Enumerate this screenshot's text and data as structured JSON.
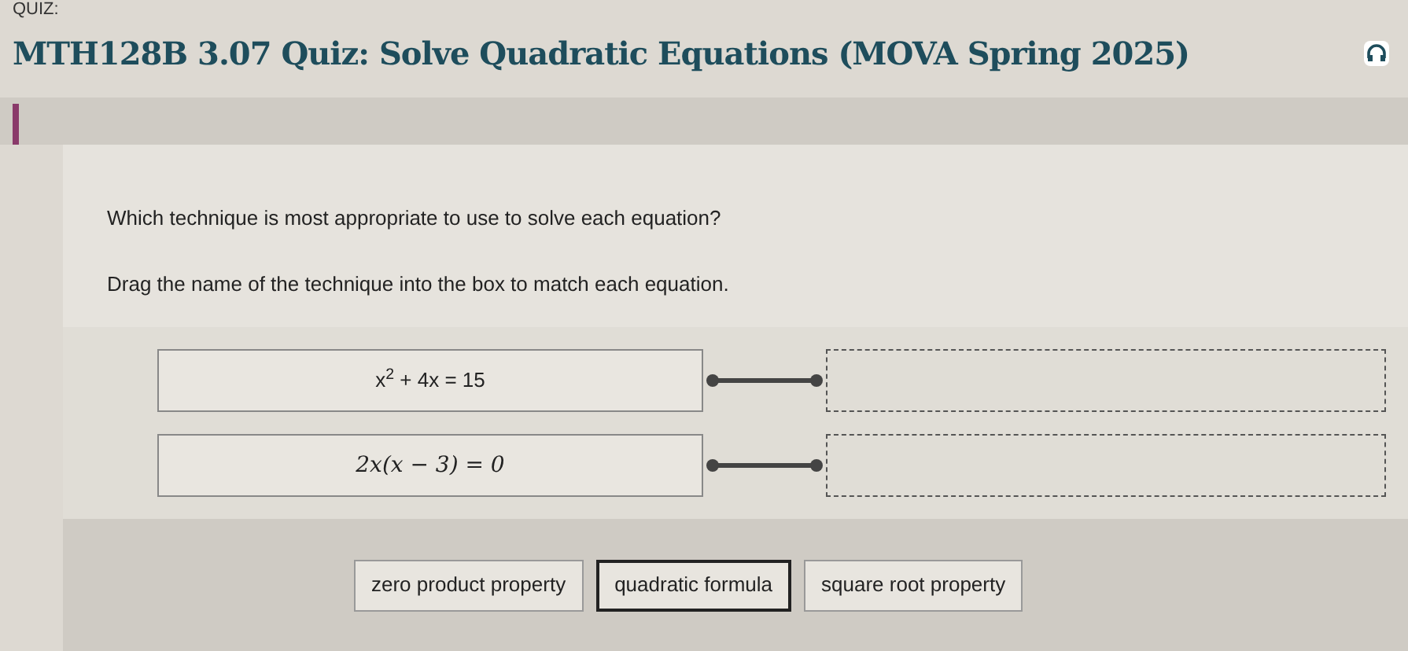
{
  "header": {
    "label": "QUIZ:",
    "title": "MTH128B 3.07 Quiz: Solve Quadratic Equations (MOVA Spring 2025)"
  },
  "question": {
    "prompt": "Which technique is most appropriate to use to solve each equation?",
    "instruction": "Drag the name of the technique into the box to match each equation."
  },
  "equations": [
    {
      "kind": "plain",
      "text": "x$^{2}$ + 4x = 15"
    },
    {
      "kind": "math",
      "text": "2x(x − 3) = 0"
    }
  ],
  "tiles": [
    {
      "label": "zero product property",
      "selected": false
    },
    {
      "label": "quadratic formula",
      "selected": true
    },
    {
      "label": "square root property",
      "selected": false
    }
  ]
}
